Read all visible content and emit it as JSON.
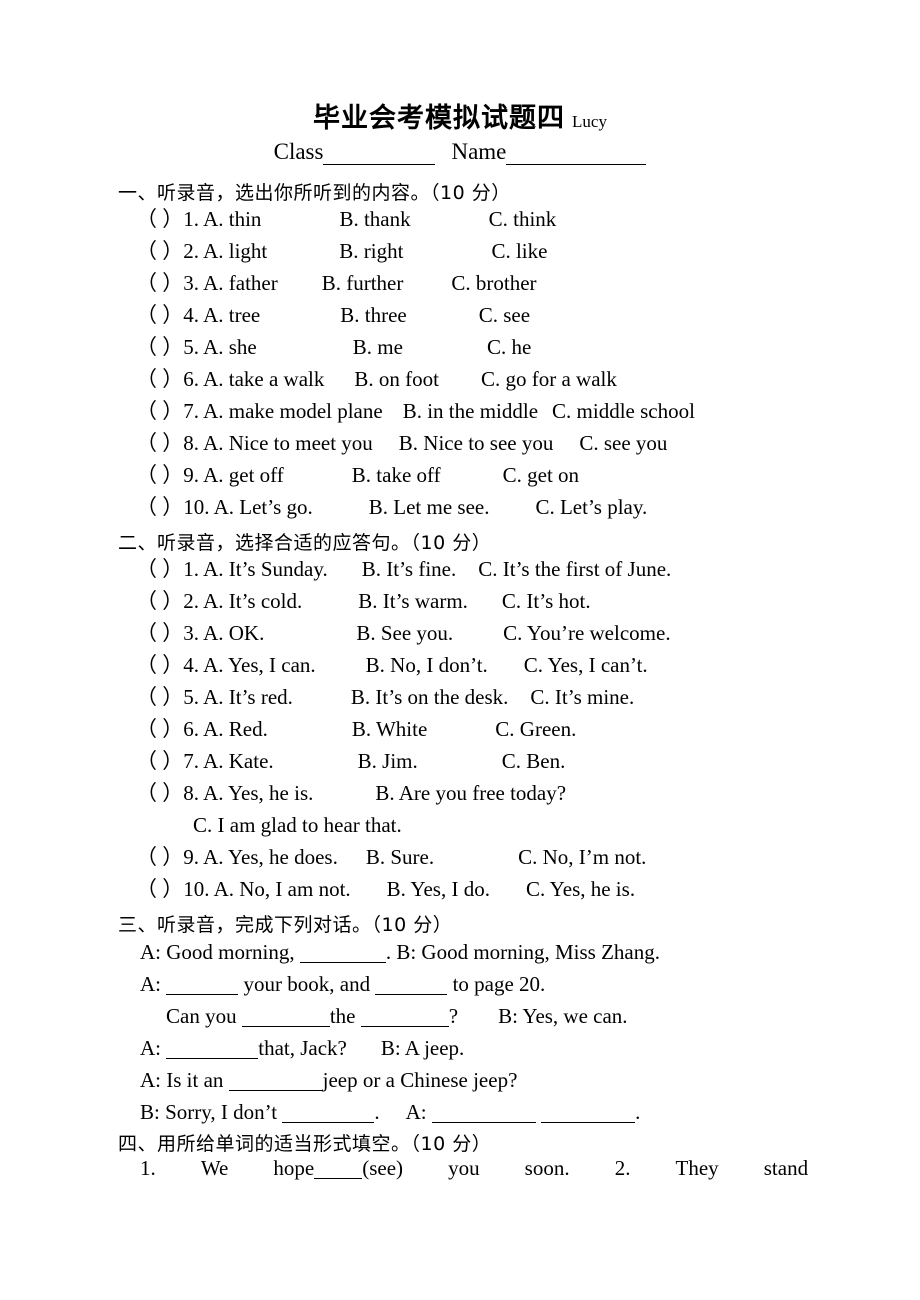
{
  "document": {
    "title_cn": "毕业会考模拟试题四",
    "title_en": "Lucy",
    "class_label": "Class",
    "name_label": "Name"
  },
  "sections": [
    {
      "heading": "一、听录音，选出你所听到的内容。（10 分）",
      "items": [
        {
          "mark": "（  ）",
          "num": "1.",
          "a": "A. thin",
          "b": "B. thank",
          "c": "C. think"
        },
        {
          "mark": "（  ）",
          "num": "2.",
          "a": "A. light",
          "b": "B. right",
          "c": "C. like"
        },
        {
          "mark": "（  ）",
          "num": "3.",
          "a": "A. father",
          "b": "B. further",
          "c": "C. brother"
        },
        {
          "mark": "（  ）",
          "num": "4.",
          "a": "A. tree",
          "b": "B. three",
          "c": "C. see"
        },
        {
          "mark": "（  ）",
          "num": "5.",
          "a": "A. she",
          "b": "B. me",
          "c": "C. he"
        },
        {
          "mark": "（  ）",
          "num": "6.",
          "a": "A. take a walk",
          "b": "B. on foot",
          "c": "C. go for a walk"
        },
        {
          "mark": "（  ）",
          "num": "7.",
          "a": "A. make model plane",
          "b": "B. in the middle",
          "c": "C. middle school"
        },
        {
          "mark": "（  ）",
          "num": "8.",
          "a": "A. Nice to meet you",
          "b": "B. Nice to see you",
          "c": "C. see you"
        },
        {
          "mark": "（  ）",
          "num": "9.",
          "a": "A. get off",
          "b": "B. take off",
          "c": "C. get on"
        },
        {
          "mark": "（  ）",
          "num": "10.",
          "a": "A. Let’s go.",
          "b": "B. Let me see.",
          "c": "C. Let’s play."
        }
      ]
    },
    {
      "heading": "二、听录音，选择合适的应答句。（10 分）",
      "items": [
        {
          "mark": "（  ）",
          "num": "1.",
          "a": "A. It’s Sunday.",
          "b": "B. It’s fine.",
          "c": "C. It’s the first of June."
        },
        {
          "mark": "（  ）",
          "num": "2.",
          "a": "A. It’s cold.",
          "b": "B. It’s warm.",
          "c": "C. It’s hot."
        },
        {
          "mark": "（  ）",
          "num": "3.",
          "a": "A. OK.",
          "b": "B. See you.",
          "c": "C. You’re welcome."
        },
        {
          "mark": "（  ）",
          "num": "4.",
          "a": "A. Yes, I can.",
          "b": "B. No, I don’t.",
          "c": "C. Yes, I can’t."
        },
        {
          "mark": "（  ）",
          "num": "5.",
          "a": "A. It’s red.",
          "b": "B. It’s on the desk.",
          "c": "C. It’s mine."
        },
        {
          "mark": "（  ）",
          "num": "6.",
          "a": "A. Red.",
          "b": "B. White",
          "c": "C. Green."
        },
        {
          "mark": "（  ）",
          "num": "7.",
          "a": "A. Kate.",
          "b": "B. Jim.",
          "c": "C. Ben."
        },
        {
          "mark": "（  ）",
          "num": "8.",
          "a": "A. Yes, he is.",
          "b": "B. Are you free today?",
          "c": "C. I am glad to hear that.",
          "c_wrapped": true
        },
        {
          "mark": "（  ）",
          "num": "9.",
          "a": "A. Yes, he does.",
          "b": "B. Sure.",
          "c": "C. No, I’m not."
        },
        {
          "mark": "（  ）",
          "num": "10.",
          "a": "A. No, I am not.",
          "b": "B. Yes, I do.",
          "c": "C. Yes, he is."
        }
      ]
    },
    {
      "heading": "三、听录音，完成下列对话。（10 分）",
      "dialogue": [
        {
          "p1": "A: Good morning,",
          "p2": ". B: Good morning, Miss Zhang."
        },
        {
          "p1": "A:",
          "p2": "your book, and",
          "p3": "to page 20."
        },
        {
          "p1": "Can you",
          "p2": "the",
          "p3": "?",
          "p4": "B: Yes, we can.",
          "indent": true
        },
        {
          "p1": "A:",
          "p2": "that, Jack?",
          "p3": "B: A jeep."
        },
        {
          "p1": "A: Is it an",
          "p2": "jeep or a Chinese jeep?"
        },
        {
          "p1": "B: Sorry, I don’t",
          "p2": ".",
          "p3": "A:",
          "p4": "."
        }
      ]
    },
    {
      "heading": "四、用所给单词的适当形式填空。（10 分）",
      "last_line": {
        "s1": "1.",
        "s2": "We",
        "s3": "hope",
        "s4": "(see)",
        "s5": "you",
        "s6": "soon.",
        "s7": "2.",
        "s8": "They",
        "s9": "stand"
      }
    }
  ]
}
